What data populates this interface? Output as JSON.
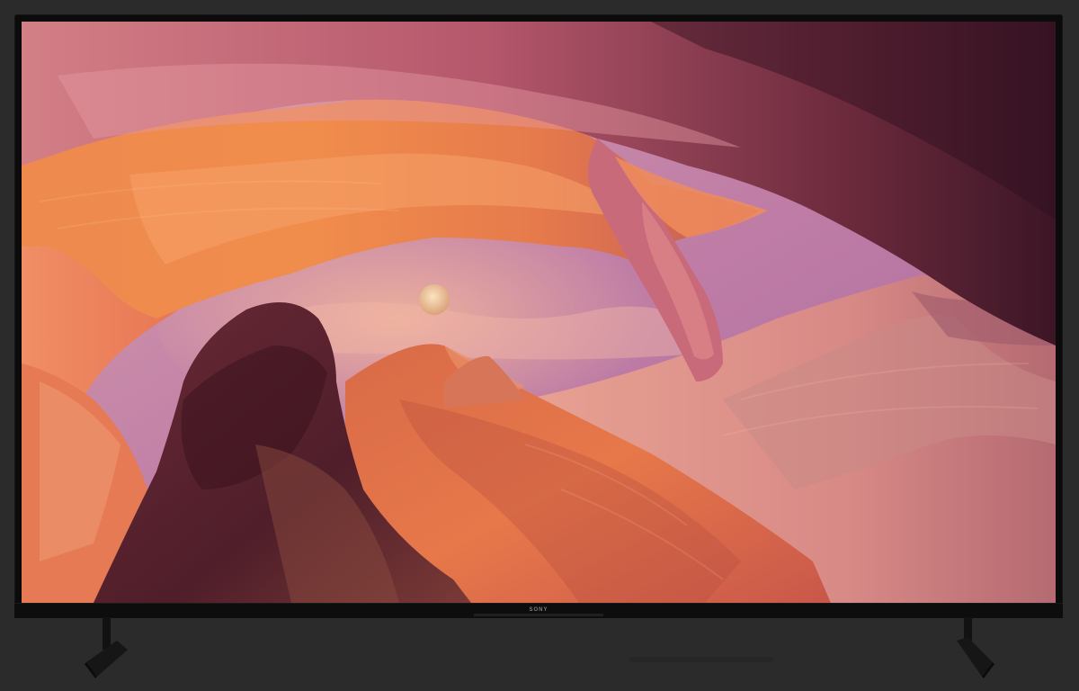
{
  "tv": {
    "brand_label": "SONY",
    "colors": {
      "background": "#2b2b2b",
      "bezel": "#0b0b0b",
      "sky": "#c98aa0",
      "rock_warm": "#e0703e",
      "rock_pink": "#d98a8a",
      "rock_dark": "#5a1f2a",
      "moon": "#f3d2a6"
    }
  }
}
